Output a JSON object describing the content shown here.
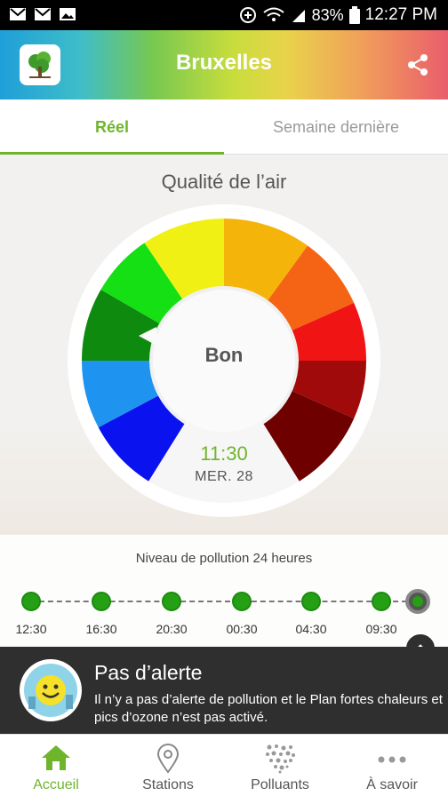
{
  "status_bar": {
    "battery": "83%",
    "time": "12:27 PM"
  },
  "header": {
    "title": "Bruxelles"
  },
  "tabs": [
    {
      "label": "Réel",
      "active": true
    },
    {
      "label": "Semaine dernière",
      "active": false
    }
  ],
  "quality": {
    "title": "Qualité de l’air",
    "status": "Bon",
    "time": "11:30",
    "date": "MER. 28",
    "scale_colors": [
      "#1e93f0",
      "#0a12f0",
      "#0e8a0e",
      "#14e014",
      "#f0f014",
      "#f5b40a",
      "#f56414",
      "#f01414",
      "#a00a0a",
      "#6e0000"
    ],
    "selected_level": "#0e8a0e"
  },
  "timeline": {
    "title": "Niveau de pollution 24 heures",
    "points": [
      {
        "time": "12:30"
      },
      {
        "time": "16:30"
      },
      {
        "time": "20:30"
      },
      {
        "time": "00:30"
      },
      {
        "time": "04:30"
      },
      {
        "time": "09:30"
      }
    ],
    "dot_color": "#25a014"
  },
  "alert": {
    "title": "Pas d’alerte",
    "text": "Il n’y a pas d’alerte de pollution et le Plan fortes chaleurs et pics d’ozone n’est pas activé."
  },
  "bottom_nav": [
    {
      "label": "Accueil",
      "icon": "home-icon",
      "active": true
    },
    {
      "label": "Stations",
      "icon": "map-pin-icon",
      "active": false
    },
    {
      "label": "Polluants",
      "icon": "particles-icon",
      "active": false
    },
    {
      "label": "À savoir",
      "icon": "more-dots-icon",
      "active": false
    }
  ],
  "colors": {
    "accent_green": "#6fb52c",
    "alert_bg": "#2f2f2f"
  }
}
